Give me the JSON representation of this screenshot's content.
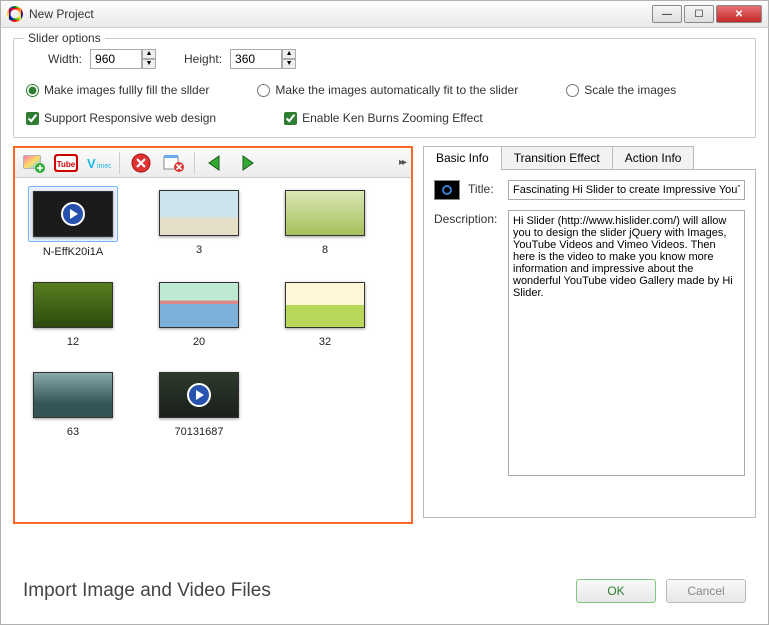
{
  "window": {
    "title": "New Project"
  },
  "options": {
    "legend": "Slider options",
    "width_label": "Width:",
    "width_value": "960",
    "height_label": "Height:",
    "height_value": "360",
    "radio_fill": "Make images fullly fill the sllder",
    "radio_fit": "Make the images automatically fit to the slider",
    "radio_scale": "Scale the images",
    "check_responsive": "Support Responsive web design",
    "check_kenburns": "Enable Ken Burns Zooming Effect"
  },
  "toolbar": {
    "add_image": "add-image-icon",
    "youtube": "youtube-icon",
    "vimeo": "vimeo-icon",
    "delete": "delete-icon",
    "clear": "clear-all-icon",
    "prev": "arrow-left-icon",
    "next": "arrow-right-icon",
    "expand": "▸▸"
  },
  "thumbnails": [
    {
      "label": "N-EffK20i1A",
      "kind": "video",
      "bg": "bg-dark",
      "selected": true
    },
    {
      "label": "3",
      "kind": "image",
      "bg": "bg-beach"
    },
    {
      "label": "8",
      "kind": "image",
      "bg": "bg-field"
    },
    {
      "label": "12",
      "kind": "image",
      "bg": "bg-grass"
    },
    {
      "label": "20",
      "kind": "image",
      "bg": "bg-town"
    },
    {
      "label": "32",
      "kind": "image",
      "bg": "bg-meadow"
    },
    {
      "label": "63",
      "kind": "image",
      "bg": "bg-forest"
    },
    {
      "label": "70131687",
      "kind": "video",
      "bg": "bg-video2"
    }
  ],
  "tabs": {
    "basic": "Basic Info",
    "transition": "Transition Effect",
    "action": "Action Info"
  },
  "basic": {
    "title_label": "Title:",
    "title_value": "Fascinating Hi Slider to create Impressive YouT",
    "desc_label": "Description:",
    "desc_value": "Hi Slider (http://www.hislider.com/) will allow you to design the slider jQuery with Images, YouTube Videos and Vimeo Videos. Then here is the video to make you know more information and impressive about the wonderful YouTube video Gallery made by Hi Slider."
  },
  "footer": {
    "caption": "Import Image and Video Files",
    "ok": "OK",
    "cancel": "Cancel"
  }
}
